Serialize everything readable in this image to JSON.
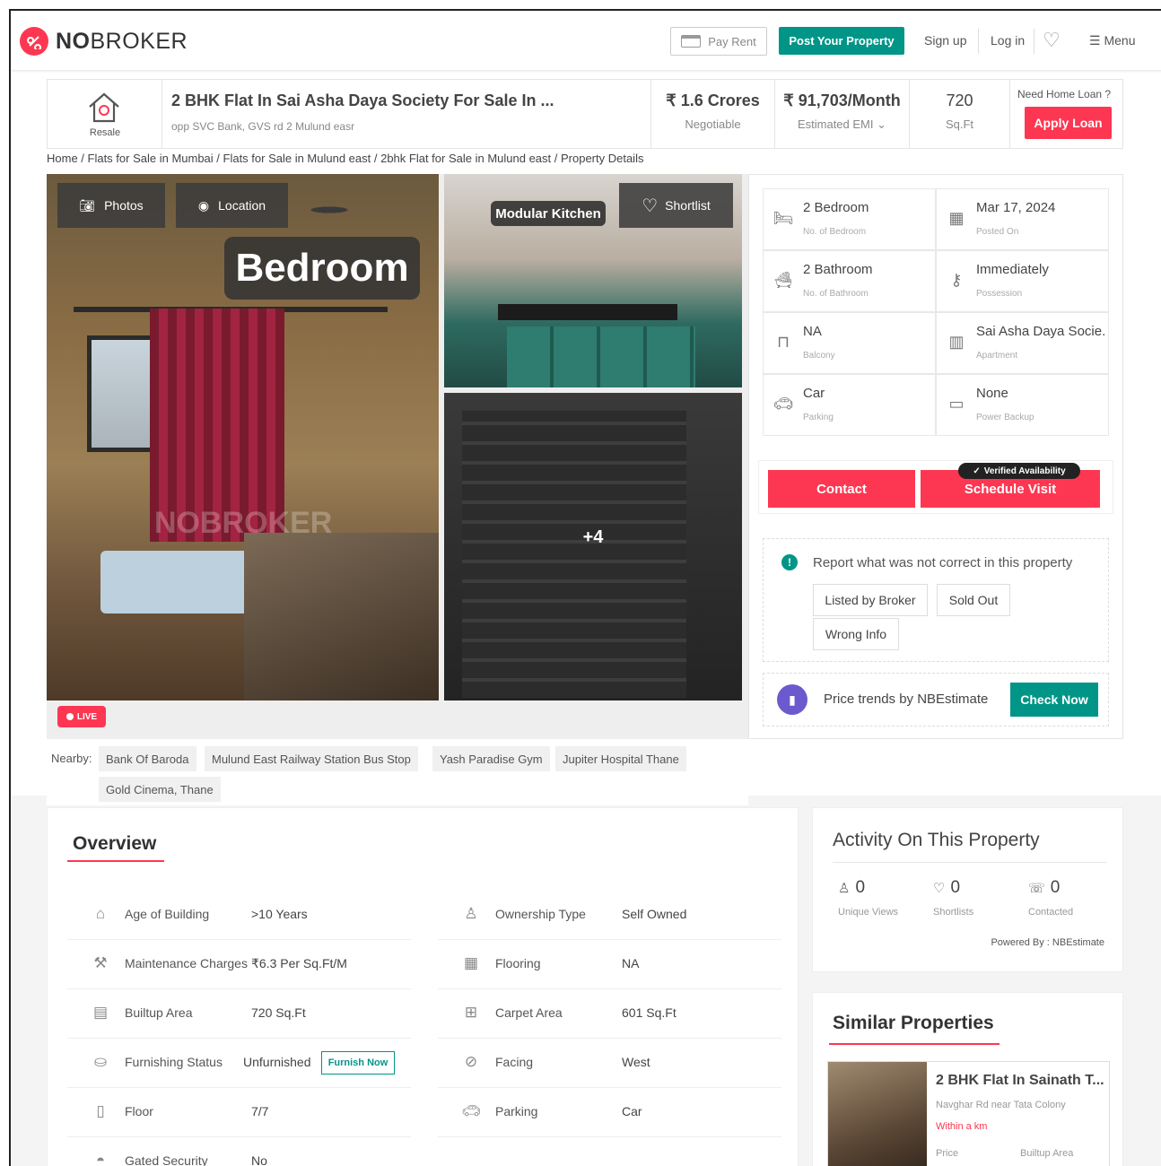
{
  "header": {
    "logo_text_bold": "NO",
    "logo_text_rest": "BROKER",
    "pay_rent": "Pay Rent",
    "post_property": "Post Your Property",
    "signup": "Sign up",
    "login": "Log in",
    "menu": "Menu"
  },
  "summary": {
    "resale_label": "Resale",
    "title": "2 BHK Flat In Sai Asha Daya Society For Sale In ...",
    "address": "opp SVC Bank, GVS rd 2 Mulund easr",
    "price": "₹ 1.6 Crores",
    "price_sub": "Negotiable",
    "emi": "₹ 91,703/Month",
    "emi_sub": "Estimated EMI",
    "area": "720",
    "area_sub": "Sq.Ft",
    "loan_question": "Need Home Loan ?",
    "loan_button": "Apply Loan"
  },
  "breadcrumb": "Home / Flats for Sale in Mumbai / Flats for Sale in Mulund east / 2bhk Flat for Sale in Mulund east / Property Details",
  "gallery": {
    "photos": "Photos",
    "location": "Location",
    "bedroom_tag": "Bedroom",
    "watermark": "NOBROKER",
    "kitchen_tag": "Modular Kitchen",
    "shortlist": "Shortlist",
    "more": "+4",
    "live": "LIVE"
  },
  "facts": [
    {
      "value": "2 Bedroom",
      "label": "No. of Bedroom",
      "icon": "bed-icon"
    },
    {
      "value": "Mar 17, 2024",
      "label": "Posted On",
      "icon": "calendar-icon"
    },
    {
      "value": "2 Bathroom",
      "label": "No. of Bathroom",
      "icon": "bathtub-icon"
    },
    {
      "value": "Immediately",
      "label": "Possession",
      "icon": "key-icon"
    },
    {
      "value": "NA",
      "label": "Balcony",
      "icon": "balcony-icon"
    },
    {
      "value": "Sai Asha Daya Socie...",
      "label": "Apartment",
      "icon": "building-icon"
    },
    {
      "value": "Car",
      "label": "Parking",
      "icon": "car-icon"
    },
    {
      "value": "None",
      "label": "Power Backup",
      "icon": "battery-icon"
    }
  ],
  "cta": {
    "contact": "Contact",
    "schedule": "Schedule Visit",
    "verified": "Verified Availability"
  },
  "report": {
    "text": "Report what was not correct in this property",
    "chips": [
      "Listed by Broker",
      "Sold Out",
      "Wrong Info"
    ]
  },
  "trend": {
    "text": "Price trends by NBEstimate",
    "button": "Check Now"
  },
  "nearby": {
    "label": "Nearby:",
    "items": [
      "Bank Of Baroda",
      "Mulund East Railway Station Bus Stop",
      "Yash Paradise Gym",
      "Jupiter Hospital Thane",
      "Gold Cinema, Thane"
    ]
  },
  "overview": {
    "title": "Overview",
    "left": [
      {
        "label": "Age of Building",
        "value": ">10 Years",
        "icon": "building-age-icon"
      },
      {
        "label": "Maintenance Charges",
        "value": "₹6.3 Per Sq.Ft/M",
        "icon": "tools-icon"
      },
      {
        "label": "Builtup Area",
        "value": "720 Sq.Ft",
        "icon": "builtup-icon"
      },
      {
        "label": "Furnishing Status",
        "value": "Unfurnished",
        "icon": "sofa-icon"
      },
      {
        "label": "Floor",
        "value": "7/7",
        "icon": "floor-icon"
      },
      {
        "label": "Gated Security",
        "value": "No",
        "icon": "guard-icon"
      }
    ],
    "right": [
      {
        "label": "Ownership Type",
        "value": "Self Owned",
        "icon": "owner-icon"
      },
      {
        "label": "Flooring",
        "value": "NA",
        "icon": "tiles-icon"
      },
      {
        "label": "Carpet Area",
        "value": "601 Sq.Ft",
        "icon": "carpet-icon"
      },
      {
        "label": "Facing",
        "value": "West",
        "icon": "compass-icon"
      },
      {
        "label": "Parking",
        "value": "Car",
        "icon": "car-icon"
      }
    ],
    "furnish_now": "Furnish Now"
  },
  "activity": {
    "title": "Activity On This Property",
    "stats": [
      {
        "value": "0",
        "label": "Unique Views",
        "icon": "user-icon"
      },
      {
        "value": "0",
        "label": "Shortlists",
        "icon": "heart-icon"
      },
      {
        "value": "0",
        "label": "Contacted",
        "icon": "phone-icon"
      }
    ],
    "powered": "Powered By : NBEstimate"
  },
  "similar": {
    "title": "Similar Properties",
    "card_title": "2 BHK Flat In Sainath T...",
    "card_sub": "Navghar Rd near Tata Colony",
    "card_distance": "Within a km",
    "card_price_label": "Price",
    "card_area_label": "Builtup Area"
  },
  "colors": {
    "accent": "#fd3752",
    "teal": "#009587"
  }
}
